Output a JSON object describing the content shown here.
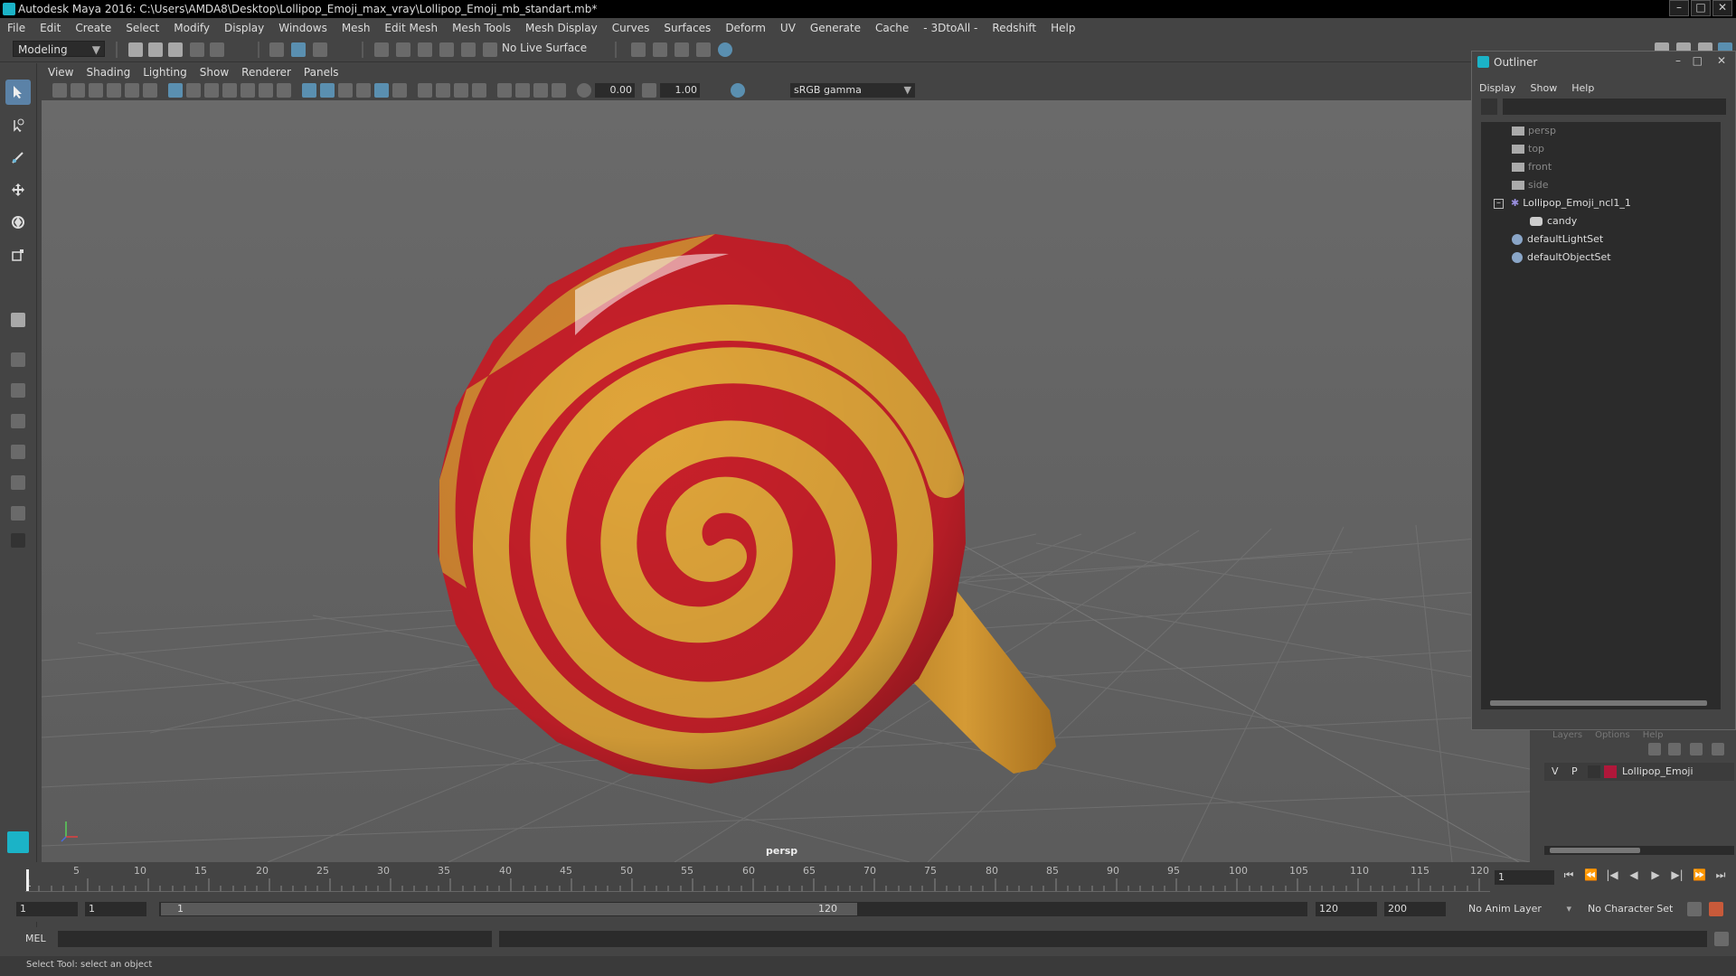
{
  "window": {
    "title": "Autodesk Maya 2016: C:\\Users\\AMDA8\\Desktop\\Lollipop_Emoji_max_vray\\Lollipop_Emoji_mb_standart.mb*",
    "minimize": "–",
    "maximize": "□",
    "close": "✕"
  },
  "menubar": [
    "File",
    "Edit",
    "Create",
    "Select",
    "Modify",
    "Display",
    "Windows",
    "Mesh",
    "Edit Mesh",
    "Mesh Tools",
    "Mesh Display",
    "Curves",
    "Surfaces",
    "Deform",
    "UV",
    "Generate",
    "Cache",
    "- 3DtoAll -",
    "Redshift",
    "Help"
  ],
  "shelf": {
    "mode": "Modeling",
    "live_surface": "No Live Surface"
  },
  "panel_menu": [
    "View",
    "Shading",
    "Lighting",
    "Show",
    "Renderer",
    "Panels"
  ],
  "panel_toolbar": {
    "exposure": "0.00",
    "gamma_value": "1.00",
    "color_space": "sRGB gamma"
  },
  "viewport": {
    "camera": "persp"
  },
  "outliner": {
    "title": "Outliner",
    "menu": [
      "Display",
      "Show",
      "Help"
    ],
    "items": [
      {
        "label": "persp",
        "icon": "camera-icon",
        "dim": true
      },
      {
        "label": "top",
        "icon": "camera-icon",
        "dim": true
      },
      {
        "label": "front",
        "icon": "camera-icon",
        "dim": true
      },
      {
        "label": "side",
        "icon": "camera-icon",
        "dim": true
      },
      {
        "label": "Lollipop_Emoji_ncl1_1",
        "icon": "group-icon",
        "dim": false
      },
      {
        "label": "candy",
        "icon": "mesh-icon",
        "dim": false
      },
      {
        "label": "defaultLightSet",
        "icon": "set-icon",
        "dim": false
      },
      {
        "label": "defaultObjectSet",
        "icon": "set-icon",
        "dim": false
      }
    ]
  },
  "layers": {
    "tabs": [
      "Layers",
      "Options",
      "Help"
    ],
    "layer": {
      "v": "V",
      "p": "P",
      "name": "Lollipop_Emoji",
      "color": "#b0173a"
    }
  },
  "timeline": {
    "ticks": [
      "5",
      "10",
      "15",
      "20",
      "25",
      "30",
      "35",
      "40",
      "45",
      "50",
      "55",
      "60",
      "65",
      "70",
      "75",
      "80",
      "85",
      "90",
      "95",
      "100",
      "105",
      "110",
      "115",
      "120"
    ],
    "start_tick": "1",
    "current_frame": "1"
  },
  "range": {
    "start": "1",
    "playback_start": "1",
    "slider_start": "1",
    "slider_end": "120",
    "playback_end": "120",
    "end": "200",
    "anim_layer": "No Anim Layer",
    "char_set": "No Character Set"
  },
  "command": {
    "lang": "MEL"
  },
  "help_line": "Select Tool: select an object",
  "colors": {
    "accent": "#5b82a7",
    "candy_red": "#c8202a",
    "candy_yellow": "#e0a53a",
    "stick": "#c9902f"
  }
}
